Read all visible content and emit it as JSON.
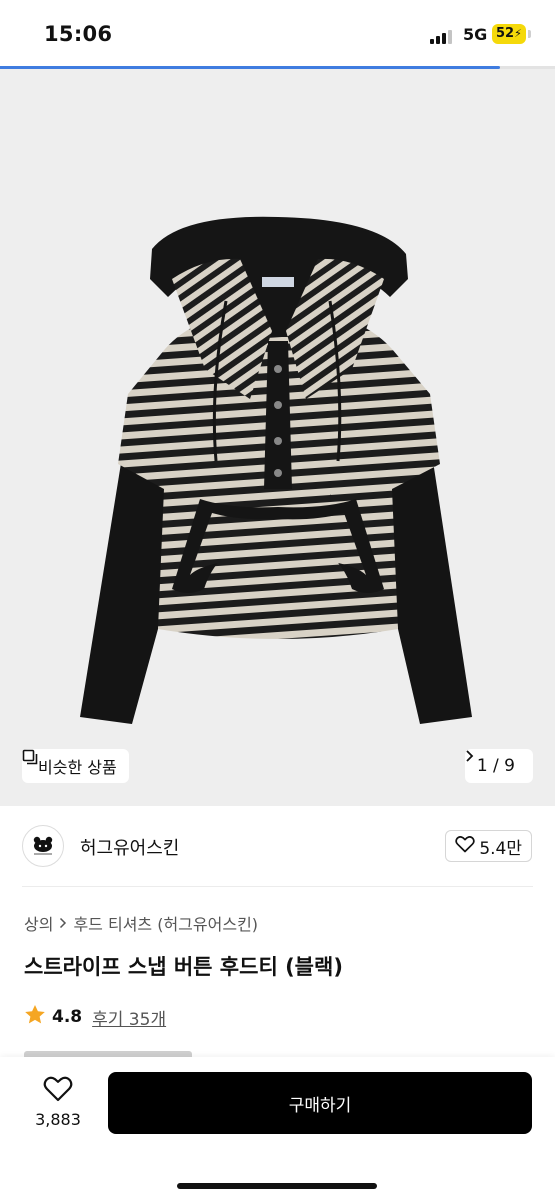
{
  "status_bar": {
    "time": "15:06",
    "network": "5G",
    "battery": "52",
    "signal_bars_active": 3,
    "icons": [
      "signal-icon",
      "battery-charging-icon"
    ]
  },
  "image_progress": {
    "fraction": 0.9,
    "color": "#3f7ce0"
  },
  "gallery": {
    "similar_label": "비슷한 상품",
    "counter": "1 / 9",
    "icons": [
      "similar-products-icon",
      "chevron-right-icon"
    ]
  },
  "brand": {
    "name": "허그유어스킨",
    "likes": "5.4만",
    "icons": [
      "brand-logo",
      "heart-outline-icon"
    ]
  },
  "product": {
    "breadcrumb": [
      "상의",
      "후드 티셔츠 (허그유어스킨)"
    ],
    "title": "스트라이프 스냅 버튼 후드티 (블랙)",
    "rating": "4.8",
    "review_label": "후기 35개",
    "rating_color": "#f5a623"
  },
  "bottom_bar": {
    "wish_count": "3,883",
    "buy_label": "구매하기",
    "buy_color": "#000000"
  }
}
